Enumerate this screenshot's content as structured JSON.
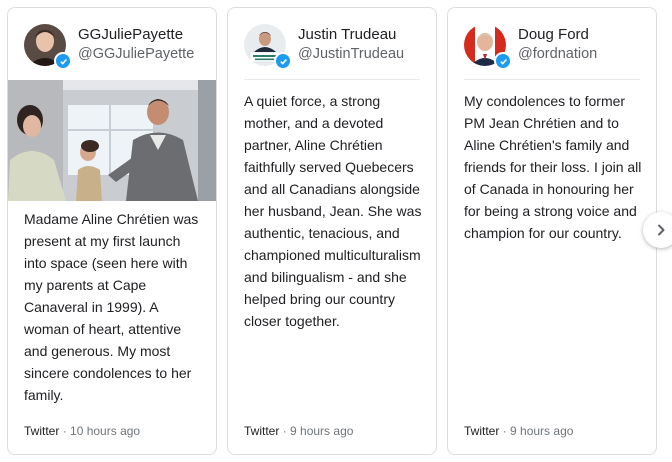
{
  "posts": [
    {
      "name": "GGJuliePayette",
      "handle": "@GGJuliePayette",
      "text": "Madame Aline Chrétien was present at my first launch into space (seen here with my parents at Cape Canaveral in 1999). A woman of heart, attentive and generous. My most sincere condolences to her family.",
      "source": "Twitter",
      "separator": "·",
      "time": "10 hours ago"
    },
    {
      "name": "Justin Trudeau",
      "handle": "@JustinTrudeau",
      "text": "A quiet force, a strong mother, and a devoted partner, Aline Chrétien faithfully served Quebecers and all Canadians alongside her husband, Jean. She was authentic, tenacious, and championed multiculturalism and bilingualism - and she helped bring our country closer together.",
      "source": "Twitter",
      "separator": "·",
      "time": "9 hours ago"
    },
    {
      "name": "Doug Ford",
      "handle": "@fordnation",
      "text": "My condolences to former PM Jean Chrétien and to Aline Chrétien's family and friends for their loss. I join all of Canada in honouring her for being a strong voice and champion for our country.",
      "source": "Twitter",
      "separator": "·",
      "time": "9 hours ago"
    }
  ],
  "icons": {
    "verified": "verified-check-icon",
    "next": "chevron-right-icon"
  },
  "colors": {
    "verified_blue": "#1d9bf0",
    "border": "#dadce0",
    "muted_text": "#5f6368"
  }
}
